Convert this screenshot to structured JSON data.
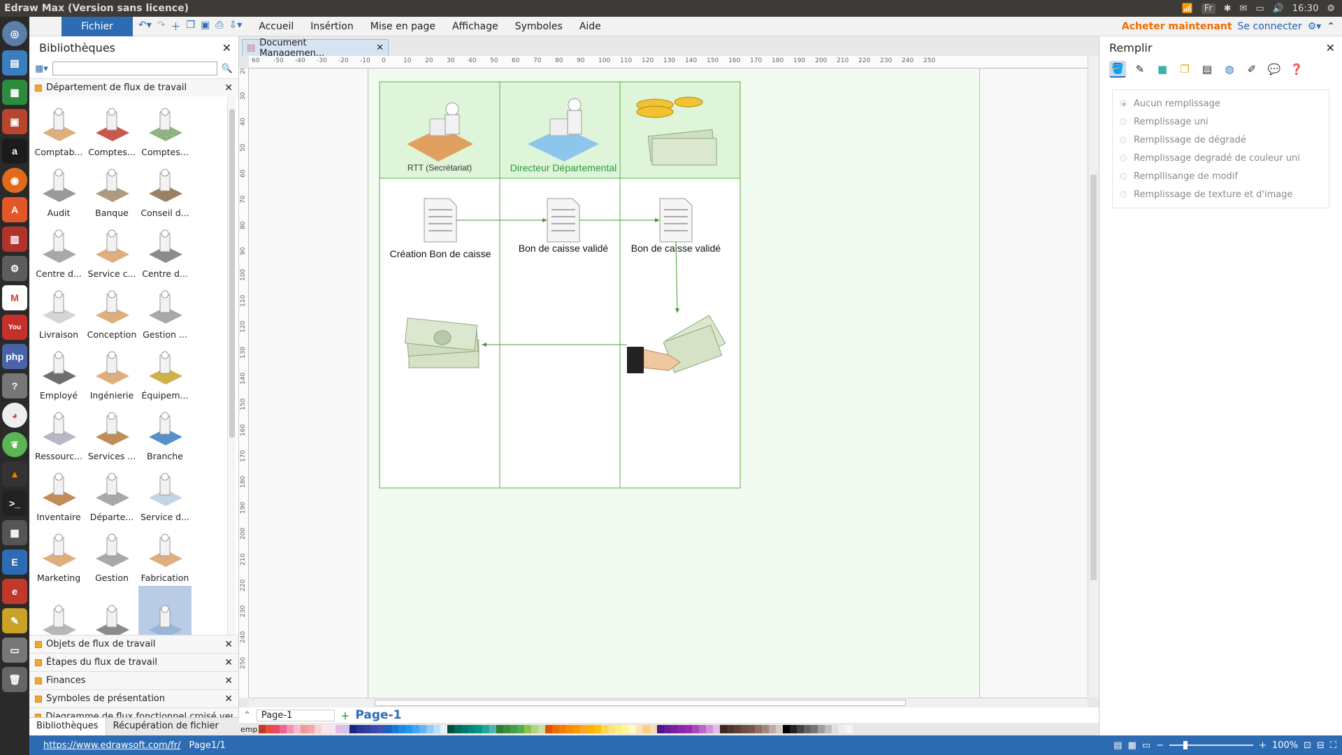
{
  "window": {
    "title": "Edraw Max (Version sans licence)",
    "lang": "Fr",
    "time": "16:30"
  },
  "menu": {
    "file": "Fichier",
    "items": [
      "Accueil",
      "Insértion",
      "Mise en page",
      "Affichage",
      "Symboles",
      "Aide"
    ],
    "buy": "Acheter maintenant",
    "login": "Se connecter"
  },
  "library": {
    "title": "Bibliothèques",
    "open_category": "Département de flux de travail",
    "shapes": [
      {
        "label": "Comptab...",
        "icon": "accounting-icon"
      },
      {
        "label": "Comptes...",
        "icon": "accounts-payable-icon"
      },
      {
        "label": "Comptes...",
        "icon": "accounts-receivable-icon"
      },
      {
        "label": "Audit",
        "icon": "audit-icon"
      },
      {
        "label": "Banque",
        "icon": "bank-icon"
      },
      {
        "label": "Conseil d...",
        "icon": "board-icon"
      },
      {
        "label": "Centre d...",
        "icon": "copy-center-icon"
      },
      {
        "label": "Service c...",
        "icon": "customer-service-icon"
      },
      {
        "label": "Centre d...",
        "icon": "data-center-icon"
      },
      {
        "label": "Livraison",
        "icon": "delivery-icon"
      },
      {
        "label": "Conception",
        "icon": "design-icon"
      },
      {
        "label": "Gestion ...",
        "icon": "management-icon"
      },
      {
        "label": "Employé",
        "icon": "employee-icon"
      },
      {
        "label": "Ingénierie",
        "icon": "engineering-icon"
      },
      {
        "label": "Équipem...",
        "icon": "equipment-icon"
      },
      {
        "label": "Ressourc...",
        "icon": "resources-icon"
      },
      {
        "label": "Services ...",
        "icon": "services-icon"
      },
      {
        "label": "Branche",
        "icon": "branch-icon"
      },
      {
        "label": "Inventaire",
        "icon": "inventory-icon"
      },
      {
        "label": "Départe...",
        "icon": "legal-department-icon"
      },
      {
        "label": "Service d...",
        "icon": "mail-service-icon"
      },
      {
        "label": "Marketing",
        "icon": "marketing-icon"
      },
      {
        "label": "Gestion",
        "icon": "org-management-icon"
      },
      {
        "label": "Fabrication",
        "icon": "manufacturing-icon"
      },
      {
        "label": "",
        "icon": "car-icon"
      },
      {
        "label": "",
        "icon": "worker-icon"
      },
      {
        "label": "",
        "icon": "workstation-icon"
      }
    ],
    "categories": [
      "Objets de flux de travail",
      "Étapes du flux de travail",
      "Finances",
      "Symboles de présentation",
      "Diagramme de flux fonctionnel croisé vertical"
    ],
    "tabs": [
      "Bibliothèques",
      "Récupération de fichier"
    ]
  },
  "document": {
    "tab": "Document Managemen...",
    "ruler_h": [
      "60",
      "-50",
      "-40",
      "-30",
      "-20",
      "-10",
      "0",
      "10",
      "20",
      "30",
      "40",
      "50",
      "60",
      "70",
      "80",
      "90",
      "100",
      "110",
      "120",
      "130",
      "140",
      "150",
      "160",
      "170",
      "180",
      "190",
      "200",
      "210",
      "220",
      "230",
      "240",
      "250"
    ],
    "ruler_v": [
      "20",
      "30",
      "40",
      "50",
      "60",
      "70",
      "80",
      "90",
      "100",
      "110",
      "120",
      "130",
      "140",
      "150",
      "160",
      "170",
      "180",
      "190",
      "200",
      "210",
      "220",
      "230",
      "240",
      "250"
    ],
    "lanes": [
      {
        "header": "RTT (Secrétariat)"
      },
      {
        "header": "Directeur Départemental"
      },
      {
        "header": ""
      }
    ],
    "docs": [
      "Création Bon de caisse",
      "Bon de caisse validé",
      "Bon de caisse validé"
    ],
    "page_tab": "Page-1",
    "page_current": "Page-1",
    "palette_label": "emp",
    "colors": {
      "lane_header": "#dff5d9",
      "lane_border": "#5aae4a",
      "director_text": "#2a9a3a",
      "arrow": "#4a9a3a"
    }
  },
  "fill_panel": {
    "title": "Remplir",
    "options": [
      "Aucun remplissage",
      "Remplissage uni",
      "Remplissage de dégradé",
      "Remplissage degradé de couleur uni",
      "Rempllisange de modif",
      "Remplissage de texture et d'image"
    ]
  },
  "status": {
    "url": "https://www.edrawsoft.com/fr/",
    "page": "Page1/1",
    "zoom": "100%"
  }
}
